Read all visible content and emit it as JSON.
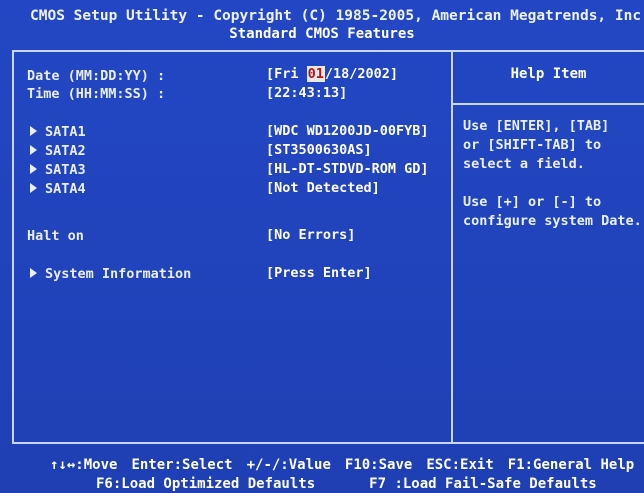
{
  "header": {
    "title": "CMOS Setup Utility - Copyright (C) 1985-2005, American Megatrends, Inc.",
    "subtitle": "Standard CMOS Features"
  },
  "fields": {
    "date": {
      "label": "Date (MM:DD:YY) :",
      "value_open": "[Fri ",
      "value_selected": "01",
      "value_close": "/18/2002]"
    },
    "time": {
      "label": "Time (HH:MM:SS) :",
      "value": "[22:43:13]"
    },
    "sata1": {
      "label": "SATA1",
      "value": "[WDC WD1200JD-00FYB]"
    },
    "sata2": {
      "label": "SATA2",
      "value": "[ST3500630AS]"
    },
    "sata3": {
      "label": "SATA3",
      "value": "[HL-DT-STDVD-ROM GD]"
    },
    "sata4": {
      "label": "SATA4",
      "value": "[Not Detected]"
    },
    "halt_on": {
      "label": "Halt on",
      "value": "[No Errors]"
    },
    "system_information": {
      "label": "System Information",
      "value": "[Press Enter]"
    }
  },
  "help": {
    "title": "Help Item",
    "text": "Use [ENTER], [TAB]\nor [SHIFT-TAB] to\nselect a field.\n\nUse [+] or [-] to\nconfigure system Date."
  },
  "footer": {
    "move": "↑↓↔:Move",
    "select": "Enter:Select",
    "value": "+/-/:Value",
    "save": "F10:Save",
    "exit": "ESC:Exit",
    "general_help": "F1:General Help",
    "optimized": "F6:Load Optimized Defaults",
    "failsafe": "F7 :Load Fail-Safe Defaults"
  }
}
